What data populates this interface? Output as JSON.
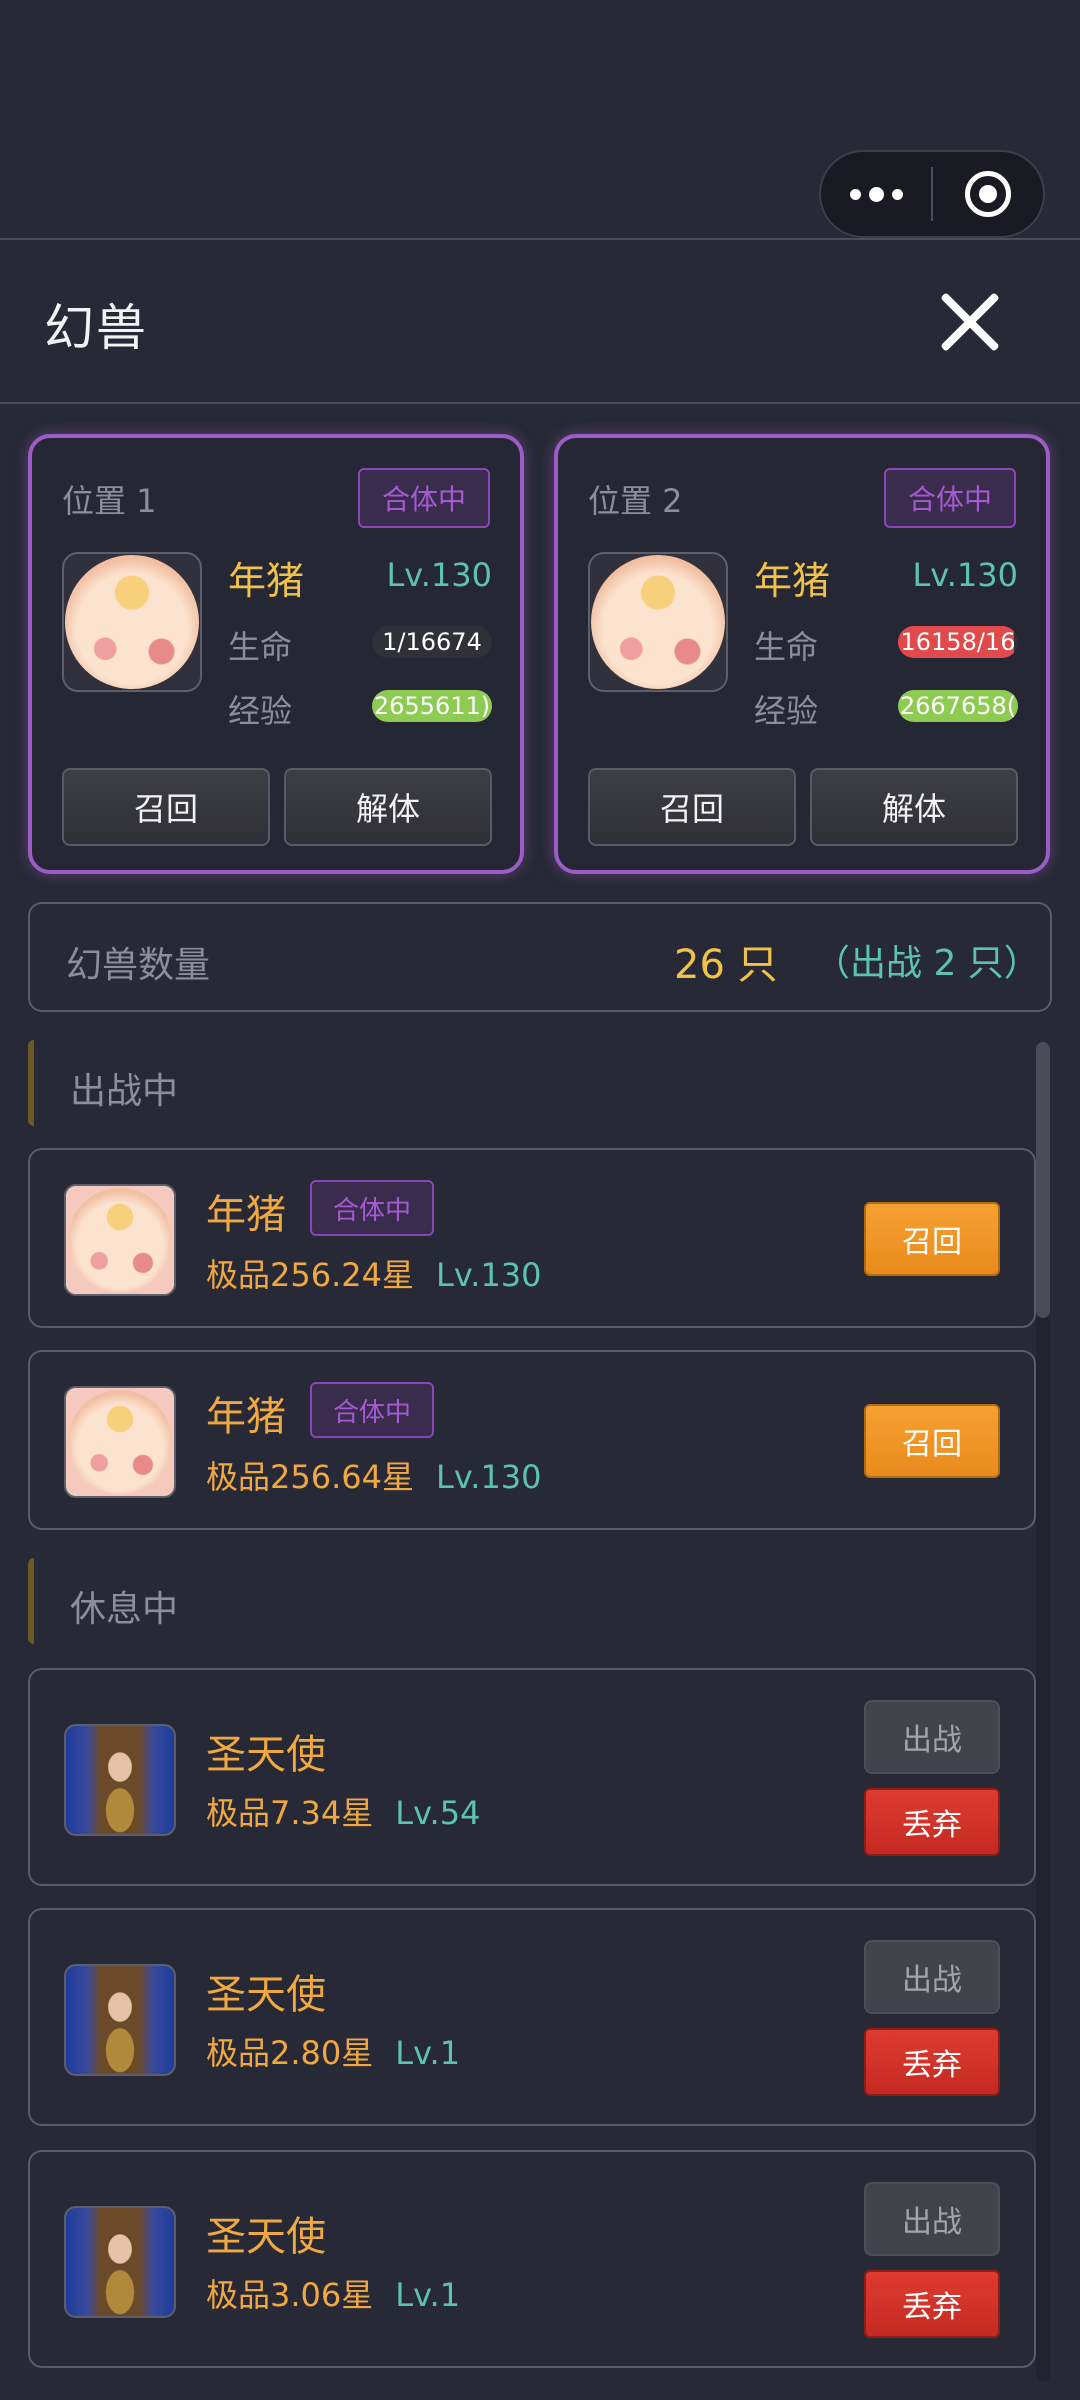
{
  "title": "幻兽",
  "slots": [
    {
      "label": "位置 1",
      "merge_tag": "合体中",
      "name": "年猪",
      "level": "Lv.130",
      "hp_label": "生命",
      "hp_value": "1/16674",
      "hp_fraction": 0.0,
      "exp_label": "经验",
      "exp_value": "2655611)",
      "exp_fraction": 1.0,
      "recall": "召回",
      "dismiss": "解体"
    },
    {
      "label": "位置 2",
      "merge_tag": "合体中",
      "name": "年猪",
      "level": "Lv.130",
      "hp_label": "生命",
      "hp_value": "16158/16",
      "hp_fraction": 0.97,
      "exp_label": "经验",
      "exp_value": "2667658(",
      "exp_fraction": 1.0,
      "recall": "召回",
      "dismiss": "解体"
    }
  ],
  "count": {
    "label": "幻兽数量",
    "value": "26 只",
    "sub": "（出战 2 只）"
  },
  "sections": {
    "active": "出战中",
    "resting": "休息中"
  },
  "active_pets": [
    {
      "name": "年猪",
      "tag": "合体中",
      "grade": "极品256.24星",
      "level": "Lv.130",
      "action": "召回"
    },
    {
      "name": "年猪",
      "tag": "合体中",
      "grade": "极品256.64星",
      "level": "Lv.130",
      "action": "召回"
    }
  ],
  "resting_pets": [
    {
      "name": "圣天使",
      "grade": "极品7.34星",
      "level": "Lv.54",
      "deploy": "出战",
      "discard": "丢弃"
    },
    {
      "name": "圣天使",
      "grade": "极品2.80星",
      "level": "Lv.1",
      "deploy": "出战",
      "discard": "丢弃"
    },
    {
      "name": "圣天使",
      "grade": "极品3.06星",
      "level": "Lv.1",
      "deploy": "出战",
      "discard": "丢弃"
    }
  ],
  "colors": {
    "background": "#272936",
    "slot_border": "#9b5cc3",
    "gold": "#f0c24a",
    "orange": "#f0a840",
    "teal": "#5cc3b4",
    "recall_button": "#f5a132",
    "discard_button": "#df3b30",
    "hp_bar_red": "#e04a4a",
    "exp_bar_green": "#8ecb52"
  },
  "icons": {
    "more": "more-dots-icon",
    "exit": "target-circle-icon",
    "close": "close-icon"
  }
}
